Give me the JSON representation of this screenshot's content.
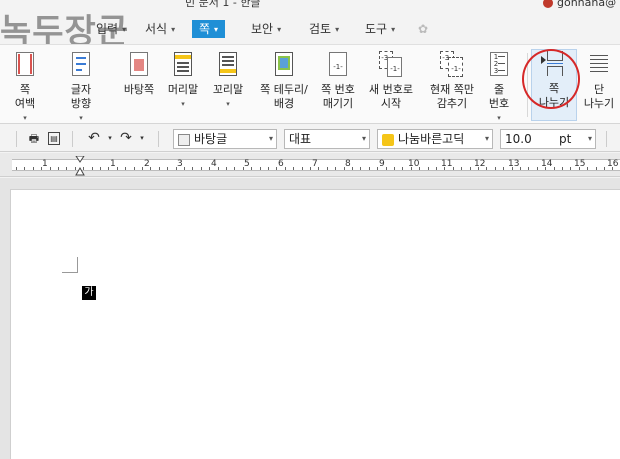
{
  "title_bar": {
    "doc_title": "빈 문서 1 - 한글",
    "user": "gonhaha@"
  },
  "watermark": {
    "text": "녹두장군",
    "url": "http://mania.tistory.com"
  },
  "menu": {
    "items": [
      {
        "label": "입력",
        "caret": "▾"
      },
      {
        "label": "서식",
        "caret": "▾"
      },
      {
        "label": "쪽",
        "caret": "▾"
      },
      {
        "label": "보안",
        "caret": "▾"
      },
      {
        "label": "검토",
        "caret": "▾"
      },
      {
        "label": "도구",
        "caret": "▾"
      }
    ]
  },
  "ribbon": {
    "buttons": [
      {
        "line1": "쪽",
        "line2": "여백",
        "dd": "▾"
      },
      {
        "line1": "글자",
        "line2": "방향",
        "dd": "▾"
      },
      {
        "line1": "바탕쪽",
        "line2": ""
      },
      {
        "line1": "머리말",
        "line2": "",
        "dd": "▾"
      },
      {
        "line1": "꼬리말",
        "line2": "",
        "dd": "▾"
      },
      {
        "line1": "쪽 테두리/",
        "line2": "배경"
      },
      {
        "line1": "쪽 번호",
        "line2": "매기기"
      },
      {
        "line1": "새 번호로",
        "line2": "시작"
      },
      {
        "line1": "현재 쪽만",
        "line2": "감추기"
      },
      {
        "line1": "줄",
        "line2": "번호",
        "dd": "▾"
      },
      {
        "line1": "쪽",
        "line2": "나누기"
      },
      {
        "line1": "단",
        "line2": "나누기"
      }
    ]
  },
  "toolbar": {
    "style": "바탕글",
    "lang": "대표",
    "font": "나눔바른고딕",
    "size": "10.0",
    "unit": "pt"
  },
  "ruler": {
    "labels": [
      "1",
      "1",
      "2",
      "3",
      "4",
      "5",
      "6",
      "7",
      "8",
      "9",
      "10",
      "11",
      "12",
      "13",
      "14",
      "15",
      "16"
    ]
  },
  "document": {
    "char": "가"
  },
  "colors": {
    "accent": "#1f8fd6",
    "highlight_circle": "#d62828"
  }
}
